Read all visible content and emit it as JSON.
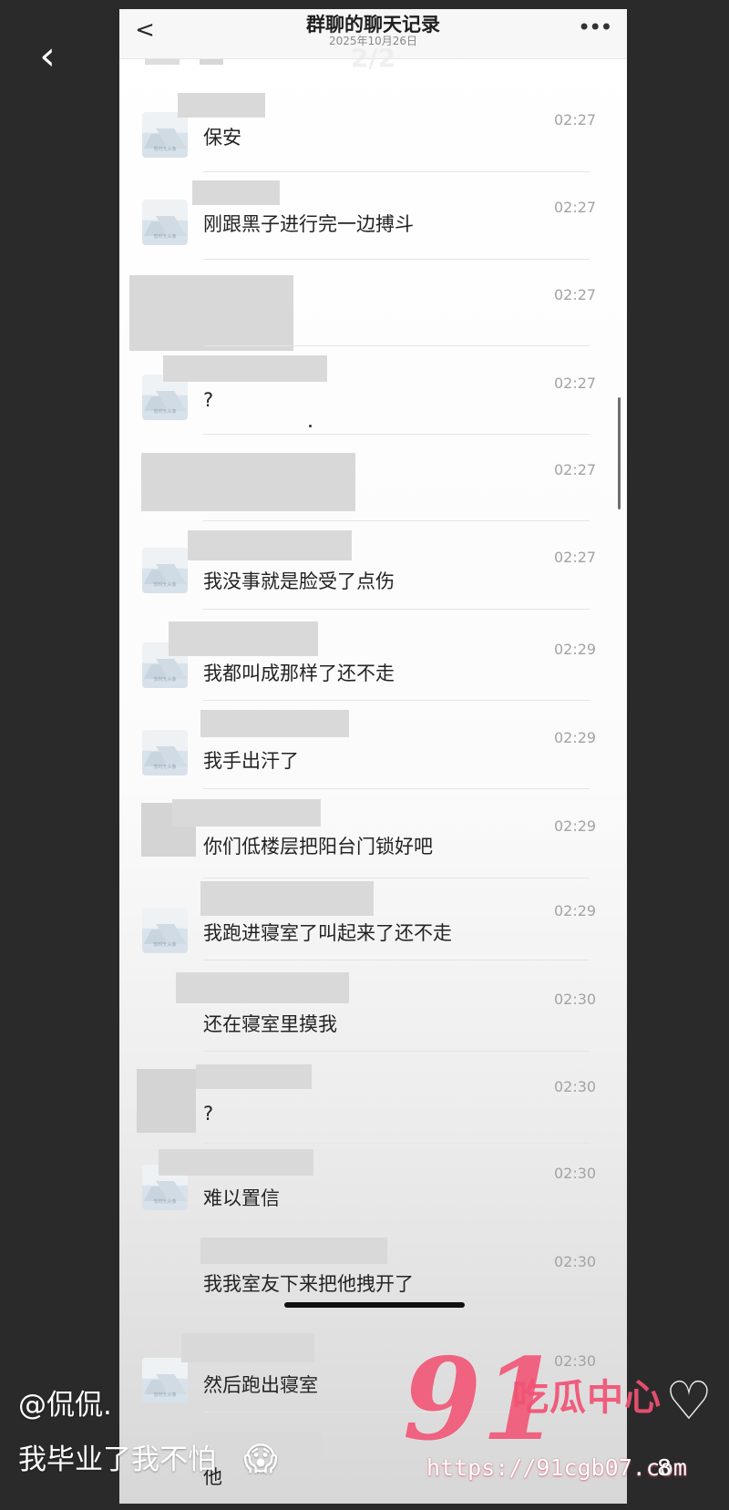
{
  "navigation": {
    "outer_back_icon": "back-icon",
    "back_glyph": "‹",
    "inner_back_glyph": "<",
    "more_glyph": "•••",
    "more_icon": "more-icon",
    "page_counter": "2/2"
  },
  "chat": {
    "title": "群聊的聊天记录",
    "date": "2025年10月26日",
    "avatar_caption": "暂时无头像",
    "messages": [
      {
        "text": "保安",
        "time": "02:27"
      },
      {
        "text": "刚跟黑子进行完一边搏斗",
        "time": "02:27"
      },
      {
        "text": "",
        "time": "02:27"
      },
      {
        "text": "?",
        "time": "02:27"
      },
      {
        "text": "",
        "time": "02:27"
      },
      {
        "text": "我没事就是脸受了点伤",
        "time": "02:27"
      },
      {
        "text": "我都叫成那样了还不走",
        "time": "02:29"
      },
      {
        "text": "我手出汗了",
        "time": "02:29"
      },
      {
        "text": "你们低楼层把阳台门锁好吧",
        "time": "02:29"
      },
      {
        "text": "我跑进寝室了叫起来了还不走",
        "time": "02:29"
      },
      {
        "text": "还在寝室里摸我",
        "time": "02:30"
      },
      {
        "text": "?",
        "time": "02:30"
      },
      {
        "text": "难以置信",
        "time": "02:30"
      },
      {
        "text": "我我室友下来把他拽开了",
        "time": "02:30"
      },
      {
        "text": "然后跑出寝室",
        "time": "02:30"
      },
      {
        "text": "他",
        "time": ""
      }
    ]
  },
  "overlay": {
    "username": "@侃侃.",
    "caption": "我毕业了我不怕",
    "emoji": "😱"
  },
  "watermark": {
    "number": "91",
    "site_name": "吃瓜中心",
    "url": "https://91cgb07.com",
    "like_count": "8",
    "heart_glyph": "♡"
  },
  "colors": {
    "background": "#2b2a2a",
    "card": "#ffffff",
    "timestamp": "#a3a3a3",
    "message_text": "#232323",
    "watermark": "#f25274"
  }
}
